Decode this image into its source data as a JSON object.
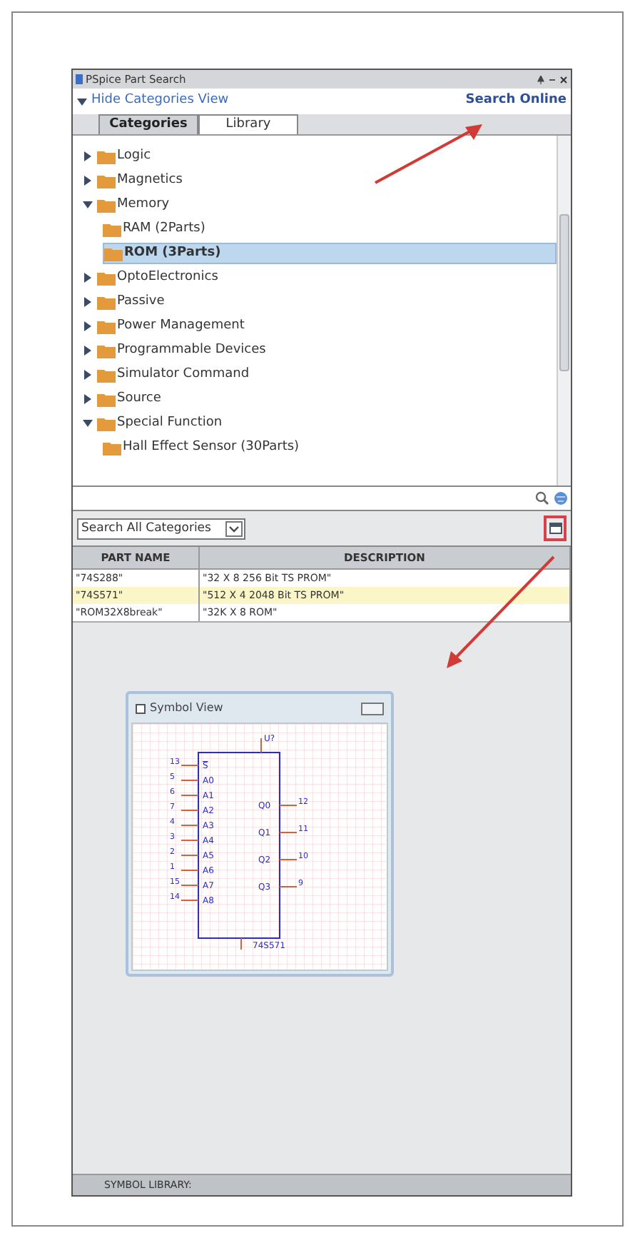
{
  "window": {
    "title": "PSpice Part Search"
  },
  "header": {
    "toggle": "Hide Categories View",
    "expanded": true,
    "link": "Search Online"
  },
  "tabs": [
    {
      "label": "Categories",
      "selected": true
    },
    {
      "label": "Library",
      "selected": false
    }
  ],
  "tree": [
    {
      "label": "Logic",
      "expanded": false,
      "selected": false
    },
    {
      "label": "Magnetics",
      "expanded": false,
      "selected": false
    },
    {
      "label": "Memory",
      "expanded": true,
      "selected": false,
      "children": [
        {
          "label": "RAM (2Parts)",
          "selected": false
        },
        {
          "label": "ROM (3Parts)",
          "selected": true
        }
      ]
    },
    {
      "label": "OptoElectronics",
      "expanded": false,
      "selected": false
    },
    {
      "label": "Passive",
      "expanded": false,
      "selected": false
    },
    {
      "label": "Power Management",
      "expanded": false,
      "selected": false
    },
    {
      "label": "Programmable Devices",
      "expanded": false,
      "selected": false
    },
    {
      "label": "Simulator Command",
      "expanded": false,
      "selected": false
    },
    {
      "label": "Source",
      "expanded": false,
      "selected": false
    },
    {
      "label": "Special Function",
      "expanded": true,
      "selected": false,
      "children": [
        {
          "label": "Hall Effect Sensor (30Parts)",
          "selected": false
        }
      ]
    }
  ],
  "scope": {
    "value": "Search All Categories"
  },
  "table": {
    "columns": [
      "PART NAME",
      "DESCRIPTION"
    ],
    "rows": [
      {
        "cells": [
          "\"74S288\"",
          "\"32 X 8 256 Bit TS PROM\""
        ],
        "selected": false
      },
      {
        "cells": [
          "\"74S571\"",
          "\"512 X 4 2048 Bit TS PROM\""
        ],
        "selected": true
      },
      {
        "cells": [
          "\"ROM32X8break\"",
          "\"32K X 8 ROM\""
        ],
        "selected": false
      }
    ]
  },
  "symbol_view": {
    "title": "Symbol View",
    "ref": "U?",
    "part": "74S571",
    "left_pins": [
      {
        "number": "13",
        "name": "S",
        "inverted": true
      },
      {
        "number": "5",
        "name": "A0",
        "inverted": false
      },
      {
        "number": "6",
        "name": "A1",
        "inverted": false
      },
      {
        "number": "7",
        "name": "A2",
        "inverted": false
      },
      {
        "number": "4",
        "name": "A3",
        "inverted": false
      },
      {
        "number": "3",
        "name": "A4",
        "inverted": false
      },
      {
        "number": "2",
        "name": "A5",
        "inverted": false
      },
      {
        "number": "1",
        "name": "A6",
        "inverted": false
      },
      {
        "number": "15",
        "name": "A7",
        "inverted": false
      },
      {
        "number": "14",
        "name": "A8",
        "inverted": false
      }
    ],
    "right_pins": [
      {
        "number": "12",
        "name": "Q0",
        "inverted": false
      },
      {
        "number": "11",
        "name": "Q1",
        "inverted": false
      },
      {
        "number": "10",
        "name": "Q2",
        "inverted": false
      },
      {
        "number": "9",
        "name": "Q3",
        "inverted": false
      }
    ]
  },
  "status_bar": "SYMBOL LIBRARY:"
}
